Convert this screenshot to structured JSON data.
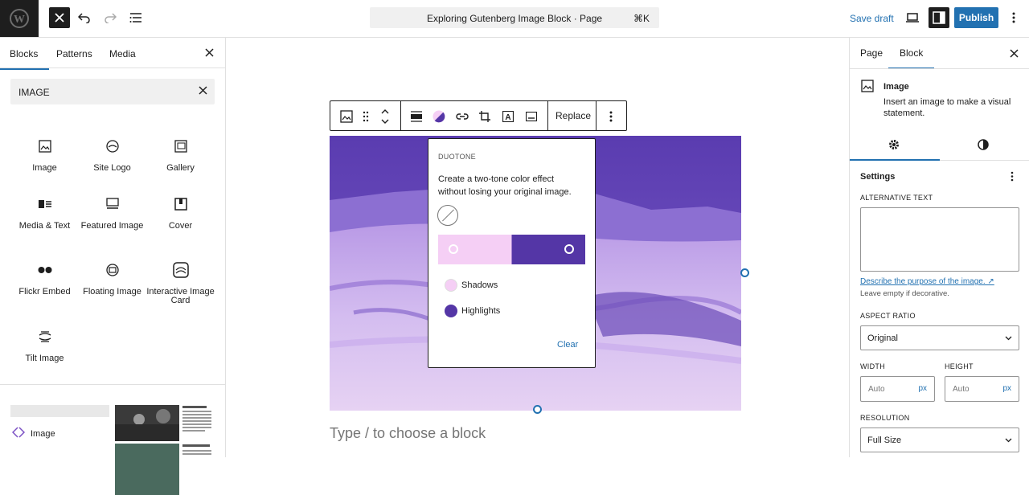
{
  "topbar": {
    "document_title": "Exploring Gutenberg Image Block · Page",
    "shortcut": "⌘K",
    "save_draft": "Save draft",
    "publish": "Publish"
  },
  "inserter": {
    "tabs": [
      "Blocks",
      "Patterns",
      "Media"
    ],
    "search_value": "IMAGE",
    "blocks": [
      {
        "label": "Image",
        "icon": "image-icon"
      },
      {
        "label": "Site Logo",
        "icon": "site-logo-icon"
      },
      {
        "label": "Gallery",
        "icon": "gallery-icon"
      },
      {
        "label": "Media & Text",
        "icon": "media-text-icon"
      },
      {
        "label": "Featured Image",
        "icon": "featured-image-icon"
      },
      {
        "label": "Cover",
        "icon": "cover-icon"
      },
      {
        "label": "Flickr Embed",
        "icon": "flickr-icon"
      },
      {
        "label": "Floating Image",
        "icon": "floating-image-icon"
      },
      {
        "label": "Interactive Image Card",
        "icon": "interactive-card-icon"
      },
      {
        "label": "Tilt Image",
        "icon": "tilt-image-icon"
      }
    ],
    "pattern_label": "Image"
  },
  "block_toolbar": {
    "replace": "Replace"
  },
  "duotone": {
    "heading": "DUOTONE",
    "description": "Create a two-tone color effect without losing your original image.",
    "shadows_label": "Shadows",
    "highlights_label": "Highlights",
    "shadows_color": "#f5cff5",
    "highlights_color": "#5436a6",
    "clear": "Clear"
  },
  "canvas": {
    "placeholder": "Type / to choose a block"
  },
  "settings": {
    "tabs": [
      "Page",
      "Block"
    ],
    "block_title": "Image",
    "block_desc": "Insert an image to make a visual statement.",
    "section": "Settings",
    "alt_label": "ALTERNATIVE TEXT",
    "alt_link": "Describe the purpose of the image. ↗",
    "alt_hint": "Leave empty if decorative.",
    "aspect_label": "ASPECT RATIO",
    "aspect_value": "Original",
    "width_label": "WIDTH",
    "height_label": "HEIGHT",
    "width_placeholder": "Auto",
    "height_placeholder": "Auto",
    "unit": "px",
    "resolution_label": "RESOLUTION",
    "resolution_value": "Full Size"
  },
  "colors": {
    "accent": "#2271b1",
    "dark": "#1e1e1e"
  }
}
